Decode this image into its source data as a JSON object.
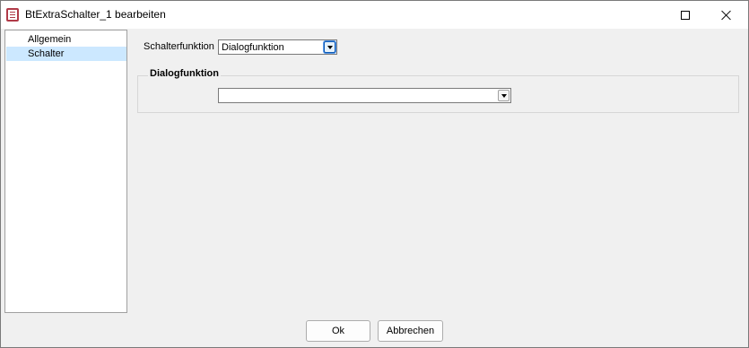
{
  "window": {
    "title": "BtExtraSchalter_1 bearbeiten",
    "icon": "document-edit-icon"
  },
  "nav": {
    "items": [
      {
        "label": "Allgemein",
        "selected": false
      },
      {
        "label": "Schalter",
        "selected": true
      }
    ]
  },
  "form": {
    "schalterfunktion_label": "Schalterfunktion",
    "schalterfunktion_value": "Dialogfunktion",
    "group_title": "Dialogfunktion",
    "dialog_select_value": ""
  },
  "footer": {
    "ok_label": "Ok",
    "cancel_label": "Abbrechen"
  },
  "colors": {
    "selection": "#cce8ff",
    "accent": "#0a58b4",
    "app_icon": "#b03a48"
  }
}
